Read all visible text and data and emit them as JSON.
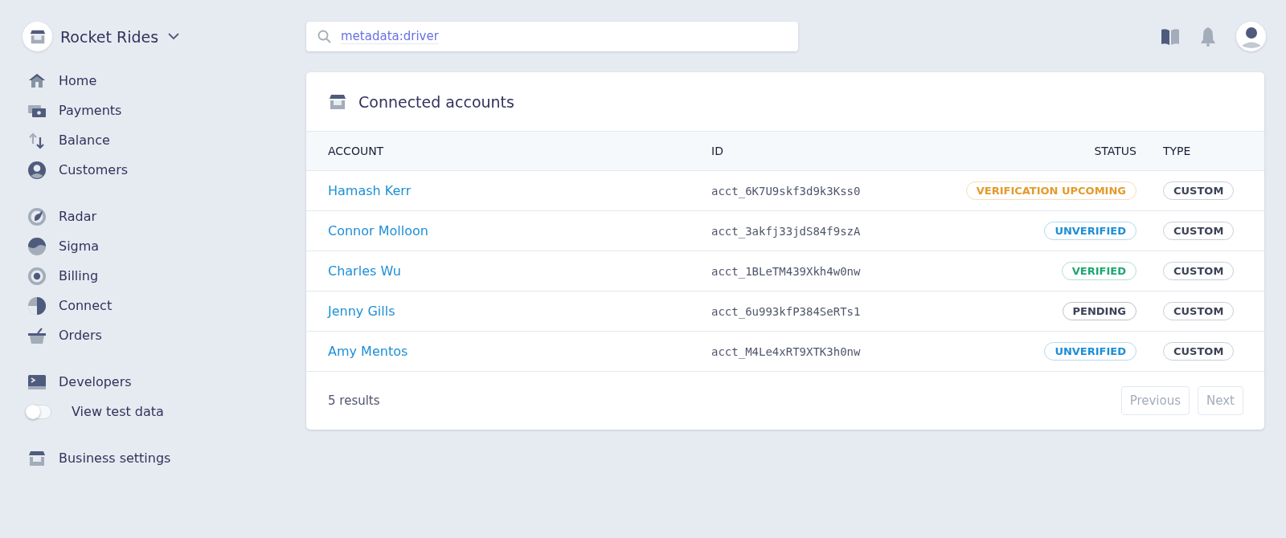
{
  "brand": {
    "name": "Rocket Rides"
  },
  "sidebar": {
    "groups": [
      [
        {
          "kind": "link",
          "label": "Home"
        },
        {
          "kind": "link",
          "label": "Payments"
        },
        {
          "kind": "link",
          "label": "Balance"
        },
        {
          "kind": "link",
          "label": "Customers"
        }
      ],
      [
        {
          "kind": "link",
          "label": "Radar"
        },
        {
          "kind": "link",
          "label": "Sigma"
        },
        {
          "kind": "link",
          "label": "Billing"
        },
        {
          "kind": "link",
          "label": "Connect"
        },
        {
          "kind": "link",
          "label": "Orders"
        }
      ],
      [
        {
          "kind": "link",
          "label": "Developers"
        },
        {
          "kind": "toggle",
          "label": "View test data",
          "on": false
        }
      ],
      [
        {
          "kind": "link",
          "label": "Business settings"
        }
      ]
    ]
  },
  "search": {
    "value": "metadata:driver"
  },
  "card": {
    "title": "Connected accounts",
    "table": {
      "columns": [
        "ACCOUNT",
        "ID",
        "STATUS",
        "TYPE"
      ],
      "rows": [
        {
          "account": "Hamash Kerr",
          "id": "acct_6K7U9skf3d9k3Kss0",
          "status": {
            "text": "VERIFICATION UPCOMING",
            "color": "#e39b2b"
          },
          "type": "CUSTOM"
        },
        {
          "account": "Connor Molloon",
          "id": "acct_3akfj33jdS84f9szA",
          "status": {
            "text": "UNVERIFIED",
            "color": "#1d8fd6"
          },
          "type": "CUSTOM"
        },
        {
          "account": "Charles Wu",
          "id": "acct_1BLeTM439Xkh4w0nw",
          "status": {
            "text": "VERIFIED",
            "color": "#1ea672"
          },
          "type": "CUSTOM"
        },
        {
          "account": "Jenny Gills",
          "id": "acct_6u993kfP384SeRTs1",
          "status": {
            "text": "PENDING",
            "color": "#3c4257"
          },
          "type": "CUSTOM"
        },
        {
          "account": "Amy Mentos",
          "id": "acct_M4Le4xRT9XTK3h0nw",
          "status": {
            "text": "UNVERIFIED",
            "color": "#1d8fd6"
          },
          "type": "CUSTOM"
        }
      ]
    },
    "footer": {
      "count": "5 results",
      "buttons": [
        {
          "label": "Previous",
          "disabled": true
        },
        {
          "label": "Next",
          "disabled": true
        }
      ]
    }
  }
}
